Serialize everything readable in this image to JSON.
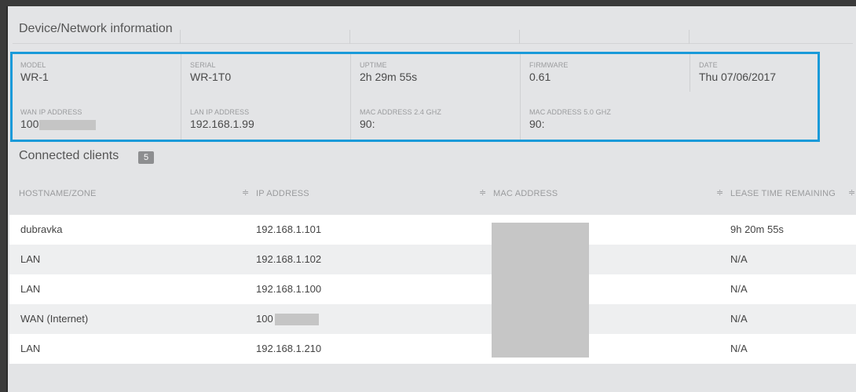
{
  "device": {
    "title": "Device/Network information",
    "fields": [
      {
        "label": "MODEL",
        "value": "WR-1"
      },
      {
        "label": "SERIAL",
        "value": "WR-1T0"
      },
      {
        "label": "UPTIME",
        "value": "2h 29m 55s"
      },
      {
        "label": "FIRMWARE",
        "value": "0.61"
      },
      {
        "label": "DATE",
        "value": "Thu 07/06/2017"
      },
      {
        "label": "WAN IP ADDRESS",
        "value": "100"
      },
      {
        "label": "LAN IP ADDRESS",
        "value": "192.168.1.99"
      },
      {
        "label": "MAC ADDRESS 2.4 GHZ",
        "value": "90:"
      },
      {
        "label": "MAC ADDRESS 5.0 GHZ",
        "value": "90:"
      }
    ]
  },
  "clients": {
    "title": "Connected clients",
    "count": "5",
    "headers": [
      "HOSTNAME/ZONE",
      "IP ADDRESS",
      "MAC ADDRESS",
      "LEASE TIME REMAINING"
    ],
    "sort_glyph": "≑",
    "rows": [
      {
        "hostname": "dubravka",
        "ip": "192.168.1.101",
        "lease": "9h 20m 55s"
      },
      {
        "hostname": "LAN",
        "ip": "192.168.1.102",
        "lease": "N/A"
      },
      {
        "hostname": "LAN",
        "ip": "192.168.1.100",
        "lease": "N/A"
      },
      {
        "hostname": "WAN (Internet)",
        "ip": "100",
        "lease": "N/A"
      },
      {
        "hostname": "LAN",
        "ip": "192.168.1.210",
        "lease": "N/A"
      }
    ]
  },
  "colors": {
    "highlight_border": "#1a9ad9",
    "panel_bg": "#e3e4e6",
    "redaction": "#c5c5c5"
  }
}
